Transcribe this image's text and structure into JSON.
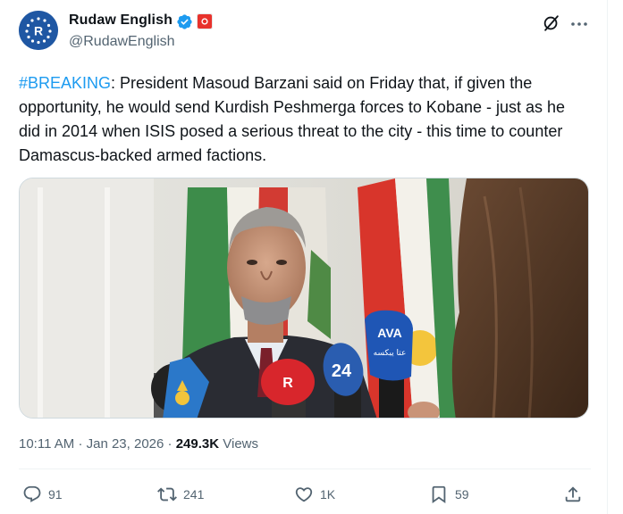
{
  "author": {
    "name": "Rudaw English",
    "handle": "@RudawEnglish",
    "avatar_letter": "R",
    "verified_icon": "verified-badge-icon",
    "affiliation_icon": "kurdistan-flag-affiliate-icon"
  },
  "tweet": {
    "hashtag": "#BREAKING",
    "text": ": President Masoud Barzani said on Friday that, if given the opportunity, he would send Kurdish Peshmerga forces to Kobane - just as he did in 2014 when ISIS posed a serious threat to the city - this time to counter Damascus-backed armed factions."
  },
  "media": {
    "mic_labels": [
      "AVA",
      "عتا يبكسه",
      "24",
      "R"
    ]
  },
  "meta": {
    "time": "10:11 AM",
    "separator": "·",
    "date": "Jan 23, 2026",
    "views_count": "249.3K",
    "views_label": "Views"
  },
  "actions": {
    "replies": "91",
    "reposts": "241",
    "likes": "1K",
    "bookmarks": "59"
  },
  "colors": {
    "accent": "#1d9bf0",
    "text": "#0f1419",
    "secondary": "#536471",
    "brand_avatar": "#1f57a3"
  }
}
